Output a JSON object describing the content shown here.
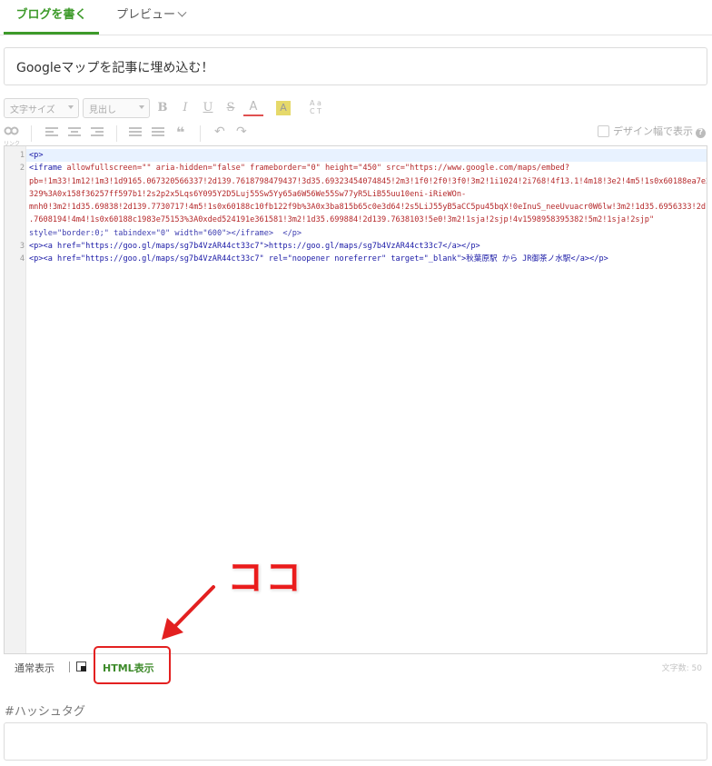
{
  "tabs": {
    "write": "ブログを書く",
    "preview": "プレビュー"
  },
  "title_value": "Googleマップを記事に埋め込む！",
  "toolbar": {
    "font_size_placeholder": "文字サイズ",
    "heading_placeholder": "見出し",
    "bold": "B",
    "italic": "I",
    "underline": "U",
    "strike": "S",
    "text_color": "A",
    "bg_color": "A",
    "link_label": "リンク",
    "design_width_label": "デザイン幅で表示",
    "help": "?"
  },
  "code_lines": {
    "line1": {
      "num": "1"
    },
    "line2": {
      "num": "2",
      "p1": "allowfullscreen=\"\" aria-hidden=\"false\" frameborder=\"0\" height=\"450\" src=\"https://www.google.com/maps/embed?",
      "p2": "pb=!1m33!1m12!1m3!1d9165.067320566337!2d139.7618798479437!3d35.69323454074845!2m3!1f0!2f0!3f0!3m2!1i1024!2i768!4f13.1!4m18!3e2!4m5!1s0x60188ea7e2f93",
      "p3": "329%3A0x158f36257ff597b1!2s2p2x5Lqs6Y095Y2D5Luj55Sw5Yy65a6W56We55Sw77yR5LiB55uu10eni-iRieWOn-",
      "p4": "mnh0!3m2!1d35.69838!2d139.7730717!4m5!1s0x60188c10fb122f9b%3A0x3ba815b65c0e3d64!2s5LiJ55yB5aCC5pu45bqX!0eInuS_neeUvuacr0W6lw!3m2!1d35.6956333!2d139",
      "p5": ".7608194!4m4!1s0x60188c1983e75153%3A0xded524191e361581!3m2!1d35.699884!2d139.7638103!5e0!3m2!1sja!2sjp!4v1598958395382!5m2!1sja!2sjp\"",
      "p6": "style=\"border:0;\" tabindex=\"0\" width=\"600\"></iframe>  </p>"
    },
    "line3": {
      "num": "3",
      "text": "<p><a href=\"https://goo.gl/maps/sg7b4VzAR44ct33c7\">https://goo.gl/maps/sg7b4VzAR44ct33c7</a></p>"
    },
    "line4": {
      "num": "4",
      "text": "<p><a href=\"https://goo.gl/maps/sg7b4VzAR44ct33c7\" rel=\"noopener noreferrer\" target=\"_blank\">秋葉原駅 から JR御茶ノ水駅</a></p>"
    }
  },
  "modebar": {
    "normal": "通常表示",
    "html": "HTML表示",
    "char_count": "文字数: 50"
  },
  "annotation": {
    "callout_text": "ココ",
    "color": "#e32020"
  },
  "hashtag": {
    "label": "#ハッシュタグ",
    "value": ""
  },
  "colors": {
    "accent": "#3d9a2a",
    "annotation_red": "#e32020"
  }
}
